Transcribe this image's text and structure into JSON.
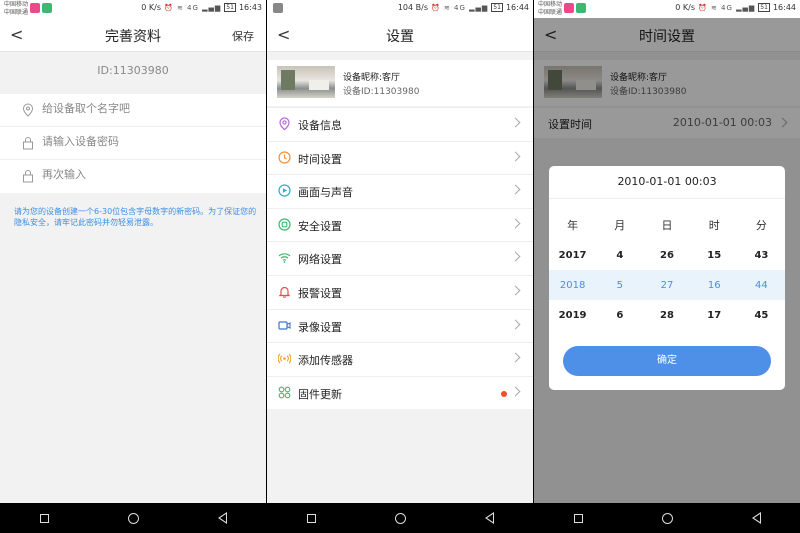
{
  "status_bars": [
    {
      "carrier1": "中国移动",
      "carrier2": "中国联通",
      "speed": "0 K/s",
      "signal": "4G",
      "battery": "51",
      "time": "16:43"
    },
    {
      "carrier1": "",
      "carrier2": "",
      "speed": "104 B/s",
      "signal": "4G",
      "battery": "51",
      "time": "16:44"
    },
    {
      "carrier1": "中国移动",
      "carrier2": "中国联通",
      "speed": "0 K/s",
      "signal": "4G",
      "battery": "51",
      "time": "16:44"
    }
  ],
  "profile_screen": {
    "title": "完善资料",
    "save_label": "保存",
    "device_id": "ID:11303980",
    "name_placeholder": "给设备取个名字吧",
    "password_placeholder": "请输入设备密码",
    "confirm_placeholder": "再次输入",
    "hint": "请为您的设备创建一个6-30位包含字母数字的新密码。为了保证您的隐私安全，请牢记此密码并勿轻易泄露。"
  },
  "settings_screen": {
    "title": "设置",
    "device_nickname": "设备昵称:客厅",
    "device_id": "设备ID:11303980",
    "menu": [
      {
        "label": "设备信息",
        "icon": "location-pin-icon",
        "color": "#b36ad6"
      },
      {
        "label": "时间设置",
        "icon": "clock-icon",
        "color": "#f0913a"
      },
      {
        "label": "画面与声音",
        "icon": "play-icon",
        "color": "#2ab0c5"
      },
      {
        "label": "安全设置",
        "icon": "shield-icon",
        "color": "#3cb871"
      },
      {
        "label": "网络设置",
        "icon": "wifi-icon",
        "color": "#3cb871"
      },
      {
        "label": "报警设置",
        "icon": "bell-icon",
        "color": "#ef4b4b"
      },
      {
        "label": "录像设置",
        "icon": "video-camera-icon",
        "color": "#3a76d8"
      },
      {
        "label": "添加传感器",
        "icon": "sensor-icon",
        "color": "#f0a020"
      },
      {
        "label": "固件更新",
        "icon": "puzzle-icon",
        "color": "#3cb871",
        "badge": true
      }
    ]
  },
  "time_screen": {
    "title": "时间设置",
    "device_nickname": "设备昵称:客厅",
    "device_id": "设备ID:11303980",
    "row_label": "设置时间",
    "row_value": "2010-01-01 00:03",
    "dialog": {
      "title": "2010-01-01 00:03",
      "headers": [
        "年",
        "月",
        "日",
        "时",
        "分"
      ],
      "rows": [
        [
          "2017",
          "4",
          "26",
          "15",
          "43"
        ],
        [
          "2018",
          "5",
          "27",
          "16",
          "44"
        ],
        [
          "2019",
          "6",
          "28",
          "17",
          "45"
        ]
      ],
      "confirm_label": "确定"
    }
  },
  "colors": {
    "accent": "#4e8fe8",
    "hint": "#3a8ee6",
    "badge": "#f04e23"
  }
}
